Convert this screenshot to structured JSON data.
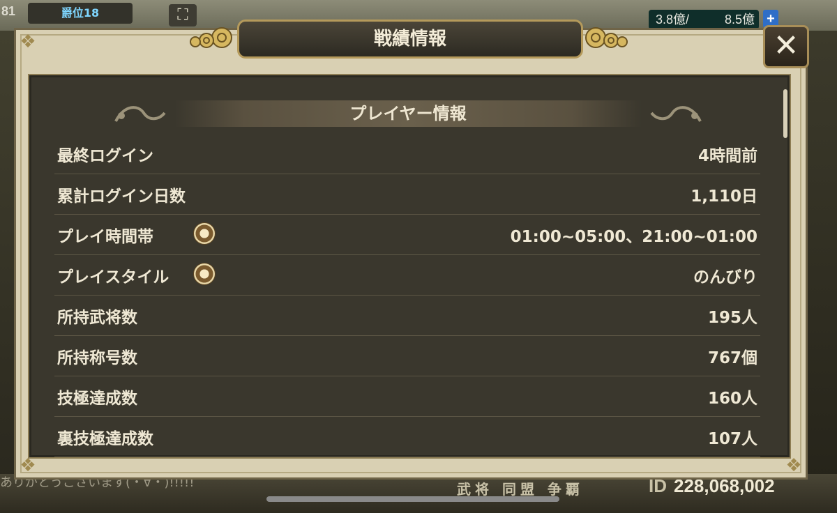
{
  "background": {
    "top_number": "81",
    "rank_badge": "爵位18",
    "resources": {
      "current": "3.8億/",
      "max": "8.5億"
    },
    "plus_label": "+",
    "bottom_tabs": "武将 同盟 争覇",
    "id_label": "ID",
    "id_value": "228,068,002",
    "chat_text": "ありがとうございます(・∀・)!!!!!"
  },
  "dialog": {
    "title": "戦績情報",
    "close_label": "✕",
    "section_title": "プレイヤー情報",
    "rows": [
      {
        "label": "最終ログイン",
        "value": "4時間前",
        "has_icon": false
      },
      {
        "label": "累計ログイン日数",
        "value": "1,110日",
        "has_icon": false
      },
      {
        "label": "プレイ時間帯",
        "value": "01:00~05:00、21:00~01:00",
        "has_icon": true
      },
      {
        "label": "プレイスタイル",
        "value": "のんびり",
        "has_icon": true
      },
      {
        "label": "所持武将数",
        "value": "195人",
        "has_icon": false
      },
      {
        "label": "所持称号数",
        "value": "767個",
        "has_icon": false
      },
      {
        "label": "技極達成数",
        "value": "160人",
        "has_icon": false
      },
      {
        "label": "裏技極達成数",
        "value": "107人",
        "has_icon": false
      }
    ]
  },
  "colors": {
    "panel": "#3a372d",
    "frame": "#d9d0b3",
    "gold_border": "#b59a5b",
    "text": "#efe8d4"
  },
  "icons": {
    "close": "close-icon",
    "info": "gear-icon",
    "ornament": "cloud-ornament-icon",
    "dragon": "dragon-ornament-icon"
  }
}
